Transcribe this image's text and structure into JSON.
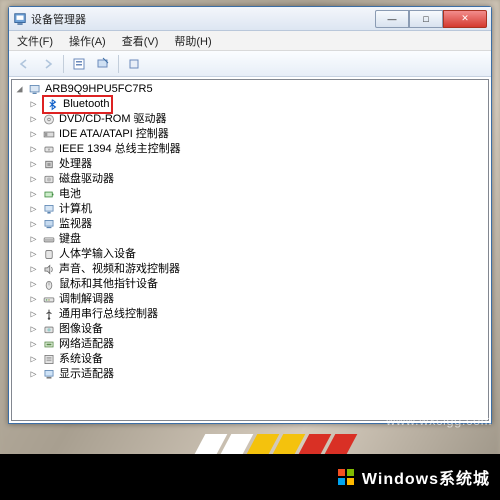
{
  "window": {
    "title": "设备管理器",
    "buttons": {
      "min": "—",
      "max": "□",
      "close": "✕"
    }
  },
  "menu": {
    "file": "文件(F)",
    "action": "操作(A)",
    "view": "查看(V)",
    "help": "帮助(H)"
  },
  "toolbar_icons": {
    "back": "back-icon",
    "fwd": "forward-icon",
    "up": "properties-icon",
    "refresh": "refresh-icon",
    "scan": "scan-icon",
    "help": "help-icon"
  },
  "tree": {
    "root": "ARB9Q9HPU5FC7R5",
    "items": [
      {
        "label": "Bluetooth",
        "icon": "bluetooth",
        "highlight": true
      },
      {
        "label": "DVD/CD-ROM 驱动器",
        "icon": "disc"
      },
      {
        "label": "IDE ATA/ATAPI 控制器",
        "icon": "ide"
      },
      {
        "label": "IEEE 1394 总线主控制器",
        "icon": "firewire"
      },
      {
        "label": "处理器",
        "icon": "cpu"
      },
      {
        "label": "磁盘驱动器",
        "icon": "hdd"
      },
      {
        "label": "电池",
        "icon": "battery"
      },
      {
        "label": "计算机",
        "icon": "computer"
      },
      {
        "label": "监视器",
        "icon": "monitor"
      },
      {
        "label": "键盘",
        "icon": "keyboard"
      },
      {
        "label": "人体学输入设备",
        "icon": "hid"
      },
      {
        "label": "声音、视频和游戏控制器",
        "icon": "sound"
      },
      {
        "label": "鼠标和其他指针设备",
        "icon": "mouse"
      },
      {
        "label": "调制解调器",
        "icon": "modem"
      },
      {
        "label": "通用串行总线控制器",
        "icon": "usb"
      },
      {
        "label": "图像设备",
        "icon": "imaging"
      },
      {
        "label": "网络适配器",
        "icon": "network"
      },
      {
        "label": "系统设备",
        "icon": "system"
      },
      {
        "label": "显示适配器",
        "icon": "display"
      }
    ]
  },
  "watermark": "www.wxclgg.com",
  "brand": "Windows系统城",
  "stripes": [
    "#ffffff",
    "#ffffff",
    "#f4c20d",
    "#f4c20d",
    "#d93025",
    "#d93025"
  ]
}
